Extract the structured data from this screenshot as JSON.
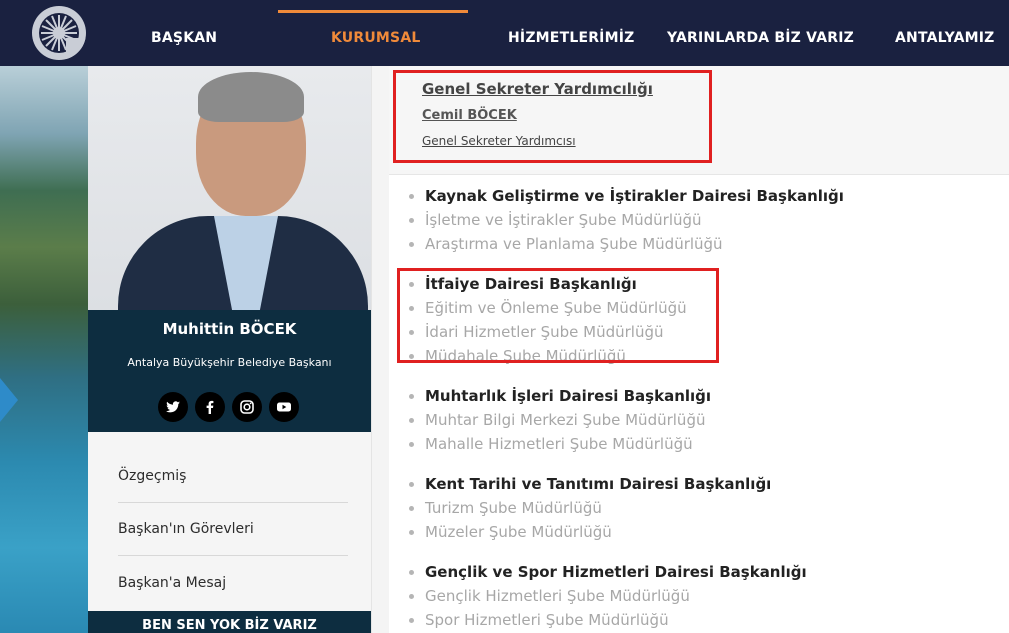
{
  "nav": {
    "items": [
      {
        "label": "BAŞKAN"
      },
      {
        "label": "KURUMSAL"
      },
      {
        "label": "HİZMETLERİMİZ"
      },
      {
        "label": "YARINLARDA BİZ VARIZ"
      },
      {
        "label": "ANTALYAMIZ"
      }
    ],
    "active_color": "#f08a3a"
  },
  "profile": {
    "name": "Muhittin BÖCEK",
    "title": "Antalya Büyükşehir Belediye Başkanı",
    "socials": [
      "twitter-icon",
      "facebook-icon",
      "instagram-icon",
      "youtube-icon"
    ],
    "menu": [
      "Özgeçmiş",
      "Başkan'ın Görevleri",
      "Başkan'a Mesaj"
    ],
    "footer": "BEN SEN YOK BİZ VARIZ"
  },
  "secretary": {
    "title": "Genel Sekreter Yardımcılığı",
    "name": "Cemil BÖCEK",
    "role": "Genel Sekreter Yardımcısı"
  },
  "departments": [
    {
      "head": "Kaynak Geliştirme ve İştirakler Dairesi Başkanlığı",
      "subs": [
        "İşletme ve İştirakler Şube Müdürlüğü",
        "Araştırma ve Planlama Şube Müdürlüğü"
      ]
    },
    {
      "head": "İtfaiye Dairesi Başkanlığı",
      "subs": [
        "Eğitim ve Önleme Şube Müdürlüğü",
        "İdari Hizmetler Şube Müdürlüğü",
        "Müdahale Şube Müdürlüğü"
      ]
    },
    {
      "head": "Muhtarlık İşleri Dairesi Başkanlığı",
      "subs": [
        "Muhtar Bilgi Merkezi Şube Müdürlüğü",
        "Mahalle Hizmetleri Şube Müdürlüğü"
      ]
    },
    {
      "head": "Kent Tarihi ve Tanıtımı Dairesi Başkanlığı",
      "subs": [
        "Turizm Şube Müdürlüğü",
        "Müzeler Şube Müdürlüğü"
      ]
    },
    {
      "head": "Gençlik ve Spor Hizmetleri Dairesi Başkanlığı",
      "subs": [
        "Gençlik Hizmetleri Şube Müdürlüğü",
        "Spor Hizmetleri Şube Müdürlüğü"
      ]
    }
  ],
  "colors": {
    "nav_bg": "#1a2140",
    "panel_bg": "#0d2d40",
    "highlight": "#e02020"
  }
}
